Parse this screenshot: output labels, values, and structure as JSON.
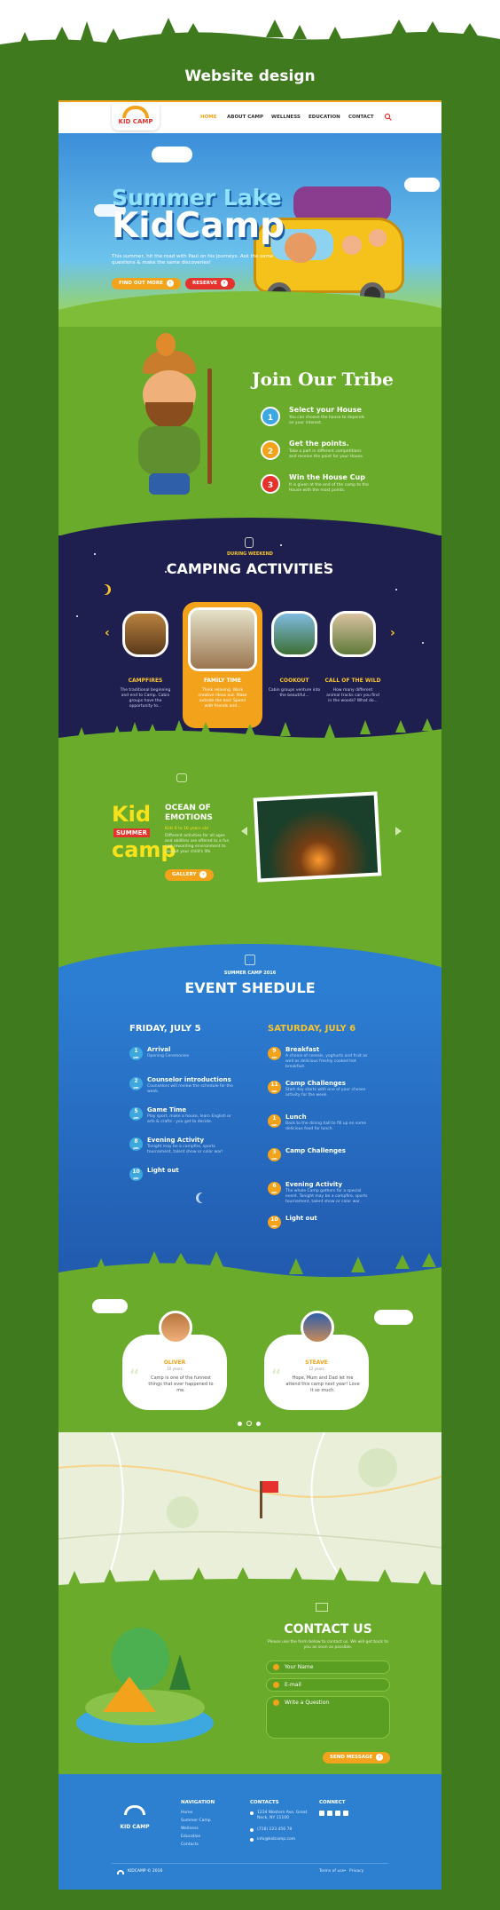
{
  "banner": {
    "title": "Website design"
  },
  "header": {
    "logo": "KID CAMP",
    "nav": [
      "HOME",
      "ABOUT CAMP",
      "WELLNESS",
      "EDUCATION",
      "CONTACT"
    ],
    "search_icon": "search-icon"
  },
  "hero": {
    "title_line1": "Summer Lake",
    "title_line2": "KidCamp",
    "subtitle": "This summer, hit the road with Paul on his journeys. Ask the same questions & make the same discoveries!",
    "btn_primary": "FIND OUT MORE",
    "btn_secondary": "RESERVE"
  },
  "tribe": {
    "title": "Join Our Tribe",
    "steps": [
      {
        "num": "1",
        "title": "Select your House",
        "desc": "You can choose the house to depends on your interest."
      },
      {
        "num": "2",
        "title": "Get the points.",
        "desc": "Take a part in different competitions and receive the point for your House."
      },
      {
        "num": "3",
        "title": "Win the House Cup",
        "desc": "It is given at the end of the camp to the House with the most points."
      }
    ]
  },
  "activities": {
    "kicker": "DURING WEEKEND",
    "title": "CAMPING ACTIVITIES",
    "items": [
      {
        "label": "CAMPFIRES",
        "desc": "The traditional beginning and end to Camp. Cabin groups have the opportunity to..."
      },
      {
        "label": "FAMILY TIME",
        "desc": "Think relaxing. Work creative ideas out. Make outside the box! Spend with friends and..."
      },
      {
        "label": "COOKOUT",
        "desc": "Cabin groups venture into the beautiful..."
      },
      {
        "label": "CALL OF THE WILD",
        "desc": "How many different animal tracks can you find in the woods? What do..."
      }
    ]
  },
  "ocean": {
    "logo_kid": "Kid",
    "logo_summer": "SUMMER",
    "logo_camp": "camp",
    "title": "OCEAN OF EMOTIONS",
    "subtitle": "Kids 6 to 16 years old",
    "desc": "Different activities for all ages and abilities are offered to a fun and rewarding environment to pursuit your child's life.",
    "button": "GALLERY"
  },
  "schedule": {
    "kicker": "SUMMER CAMP 2016",
    "title": "EVENT SHEDULE",
    "day1": "FRIDAY, JULY 5",
    "day2": "SATURDAY, JULY 6",
    "day1_events": [
      {
        "time": "1",
        "ampm": "pm",
        "title": "Arrival",
        "desc": "Opening Ceremonies"
      },
      {
        "time": "2",
        "ampm": "pm",
        "title": "Counselor introductions",
        "desc": "Counselors will review the schedule for the week."
      },
      {
        "time": "5",
        "ampm": "pm",
        "title": "Game Time",
        "desc": "Play sport, make a house, learn English or arts & crafts - you get to decide."
      },
      {
        "time": "8",
        "ampm": "pm",
        "title": "Evening Activity",
        "desc": "Tonight may be a campfire, sports tournament, talent show or color war!"
      },
      {
        "time": "10",
        "ampm": "pm",
        "title": "Light out",
        "desc": ""
      }
    ],
    "day2_events": [
      {
        "time": "9",
        "ampm": "am",
        "title": "Breakfast",
        "desc": "A choice of cereals, yoghurts and fruit as well as delicious freshly cooked hot breakfast."
      },
      {
        "time": "11",
        "ampm": "am",
        "title": "Camp Challenges",
        "desc": "Start day starts with one of your chosen activity for the week."
      },
      {
        "time": "1",
        "ampm": "pm",
        "title": "Lunch",
        "desc": "Back to the dining hall to fill up on some delicious food for lunch."
      },
      {
        "time": "3",
        "ampm": "pm",
        "title": "Camp Challenges",
        "desc": ""
      },
      {
        "time": "6",
        "ampm": "pm",
        "title": "Evening Activity",
        "desc": "The whole Camp gathers for a special event. Tonight may be a campfire, sports tournament, talent show or color war."
      },
      {
        "time": "10",
        "ampm": "pm",
        "title": "Light out",
        "desc": ""
      }
    ]
  },
  "testimonials": [
    {
      "name": "OLIVER",
      "age": "10 years",
      "quote": "Camp is one of the funnest things that ever happened to me."
    },
    {
      "name": "STEAVE",
      "age": "12 years",
      "quote": "Hope, Mum and Dad let me attend this camp next year! Love it so much."
    }
  ],
  "contact": {
    "title": "CONTACT US",
    "subtitle": "Please use the form below to contact us. We will get back to you as soon as possible.",
    "name_placeholder": "Your Name",
    "email_placeholder": "E-mail",
    "message_placeholder": "Write a Question",
    "button": "SEND MESSAGE"
  },
  "footer": {
    "logo": "KID CAMP",
    "nav_title": "NAVIGATION",
    "nav_items": [
      "Home",
      "Summer Camp",
      "Wellness",
      "Education",
      "Contacts"
    ],
    "contacts_title": "CONTACTS",
    "address": "1234 Western Ave, Great Neck, NY 11100",
    "phone": "(718) 123 456 78",
    "email": "info@kidcamp.com",
    "connect_title": "CONNECT",
    "copyright": "KIDCAMP © 2016",
    "terms": "Terms of use",
    "privacy": "Privacy"
  },
  "colors": {
    "accent": "#f2a31b",
    "green": "#6aab2c",
    "blue": "#2d7fd0",
    "night": "#1e1f4f",
    "red": "#e5322d"
  }
}
